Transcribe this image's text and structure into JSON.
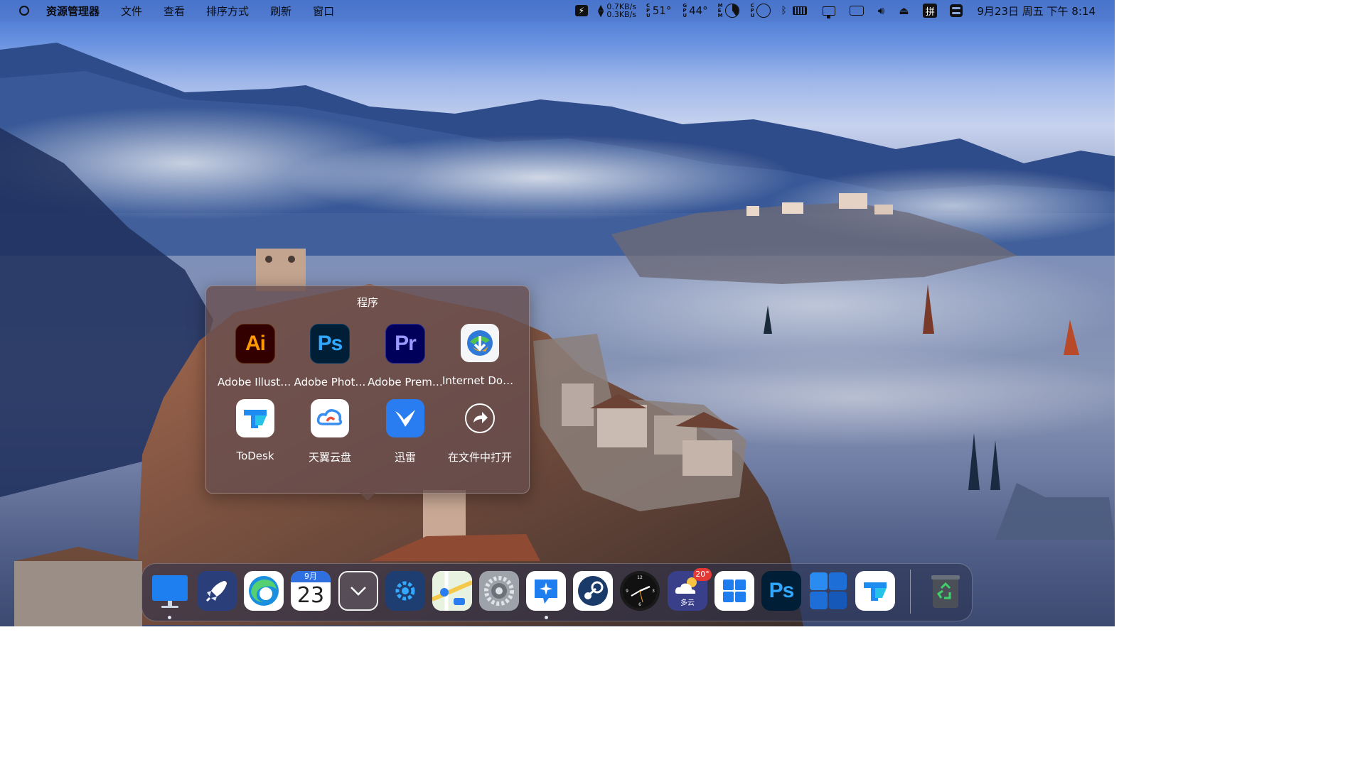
{
  "menubar": {
    "app_name": "资源管理器",
    "menus": [
      "文件",
      "查看",
      "排序方式",
      "刷新",
      "窗口"
    ],
    "net_up": "0.7KB/s",
    "net_down": "0.3KB/s",
    "cpu_label": "CPU",
    "cpu_temp": "51°",
    "gpu_label": "GPU",
    "gpu_temp": "44°",
    "mem_label": "MEM",
    "cpu2_label": "CPU",
    "ime": "拼",
    "datetime": "9月23日 周五 下午 8:14"
  },
  "popup": {
    "title": "程序",
    "apps": [
      {
        "label": "Adobe Illustr…",
        "icon_text": "Ai",
        "icon": "illustrator-icon"
      },
      {
        "label": "Adobe Phot…",
        "icon_text": "Ps",
        "icon": "photoshop-icon"
      },
      {
        "label": "Adobe Prem…",
        "icon_text": "Pr",
        "icon": "premiere-icon"
      },
      {
        "label": "Internet Dow…",
        "icon": "internet-download-manager-icon"
      },
      {
        "label": "ToDesk",
        "icon": "todesk-icon"
      },
      {
        "label": "天翼云盘",
        "icon": "tianyi-cloud-icon"
      },
      {
        "label": "迅雷",
        "icon": "xunlei-icon"
      },
      {
        "label": "在文件中打开",
        "icon": "open-in-files-icon"
      }
    ]
  },
  "dock": {
    "calendar_month": "9月",
    "calendar_day": "23",
    "weather_temp": "20°",
    "weather_text": "多云",
    "photoshop_text": "Ps",
    "items": [
      "finder",
      "launchpad",
      "edge",
      "calendar",
      "downloads-stack",
      "settings-tool",
      "maps",
      "system-settings",
      "chat-app",
      "steam",
      "clock",
      "weather",
      "windows-start",
      "photoshop",
      "windows-app",
      "todesk",
      "recycle-bin"
    ]
  },
  "colors": {
    "popup_bg": "#684e4e",
    "illustrator_bg": "#330000",
    "illustrator_fg": "#ff9a00",
    "photoshop_bg": "#001e36",
    "photoshop_fg": "#31a8ff",
    "premiere_bg": "#00005b",
    "premiere_fg": "#9999ff"
  }
}
